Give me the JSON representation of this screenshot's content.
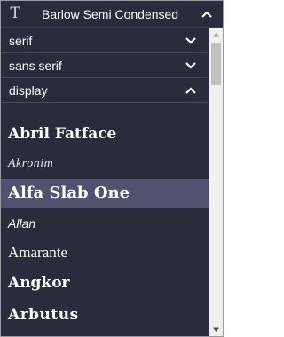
{
  "header": {
    "icon": "serif-t-icon",
    "title": "Barlow Semi Condensed",
    "chevron": "chevron-up-icon"
  },
  "categories": [
    {
      "label": "serif",
      "state": "collapsed"
    },
    {
      "label": "sans serif",
      "state": "collapsed"
    },
    {
      "label": "display",
      "state": "expanded"
    }
  ],
  "fonts": [
    {
      "name": "Abril Fatface",
      "selected": false
    },
    {
      "name": "Akronim",
      "selected": false
    },
    {
      "name": "Alfa Slab One",
      "selected": true
    },
    {
      "name": "Allan",
      "selected": false
    },
    {
      "name": "Amarante",
      "selected": false
    },
    {
      "name": "Angkor",
      "selected": false
    },
    {
      "name": "Arbutus",
      "selected": false
    }
  ],
  "colors": {
    "background": "#2c2b3c",
    "selected": "#545170",
    "divider": "#4a495e",
    "text": "#ffffff"
  }
}
